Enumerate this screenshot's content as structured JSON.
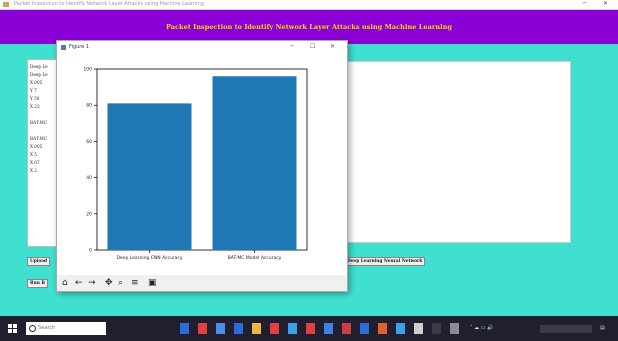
{
  "window": {
    "title": "Packet Inspection to Identify Network Layer Attacks using Machine Learning"
  },
  "header": {
    "title": "Packet Inspection to Identify Network Layer Attacks using Machine Learning",
    "bg": "#8b00d6",
    "fg": "#ffd700"
  },
  "left_panel": {
    "lines": [
      "Deep Le",
      "Deep Le",
      "X 005",
      "Y 7",
      "Y 50",
      "X 23",
      "",
      "BAT-MC",
      "",
      "BAT-MC",
      "X 005",
      "X 5",
      "X 07",
      "X 2"
    ]
  },
  "buttons": {
    "upload": "Upload",
    "run": "Run B",
    "deep_learning": "Deep Learning Neural Network"
  },
  "figure": {
    "title": "Figure 1",
    "toolbar": [
      "home-icon",
      "back-icon",
      "forward-icon",
      "pan-icon",
      "zoom-icon",
      "configure-icon",
      "save-icon"
    ]
  },
  "chart_data": {
    "type": "bar",
    "categories": [
      "Deep Learning CNN Accuracy",
      "BAT-MC Model Accuracy"
    ],
    "values": [
      81,
      96
    ],
    "ylim": [
      0,
      100
    ],
    "yticks": [
      0,
      20,
      40,
      60,
      80,
      100
    ],
    "bar_color": "#1f77b4",
    "grid": false
  },
  "taskbar": {
    "search_placeholder": "Search"
  }
}
